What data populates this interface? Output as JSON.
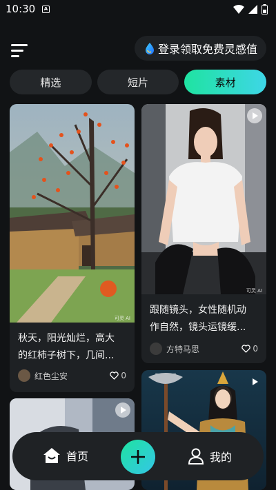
{
  "status_bar": {
    "time": "10:30",
    "notification_letter": "A"
  },
  "header": {
    "promo_text": "登录领取免费灵感值"
  },
  "tabs": [
    {
      "label": "精选",
      "active": false
    },
    {
      "label": "短片",
      "active": false
    },
    {
      "label": "素材",
      "active": true
    }
  ],
  "cards": [
    {
      "title_line1": "秋天，阳光灿烂，高大",
      "title_line2": "的红柿子树下，几间...",
      "author": "红色尘安",
      "likes": "0"
    },
    {
      "title_line1": "跟随镜头，女性随机动",
      "title_line2": "作自然，镜头运镜缓...",
      "author": "方特马思",
      "likes": "0"
    }
  ],
  "ai_mark": "可灵 AI",
  "bottom_nav": {
    "home_label": "首页",
    "me_label": "我的"
  },
  "colors": {
    "accent_start": "#1fe3a1",
    "accent_end": "#3ed6e6",
    "background": "#111315",
    "card": "#1e2124"
  }
}
